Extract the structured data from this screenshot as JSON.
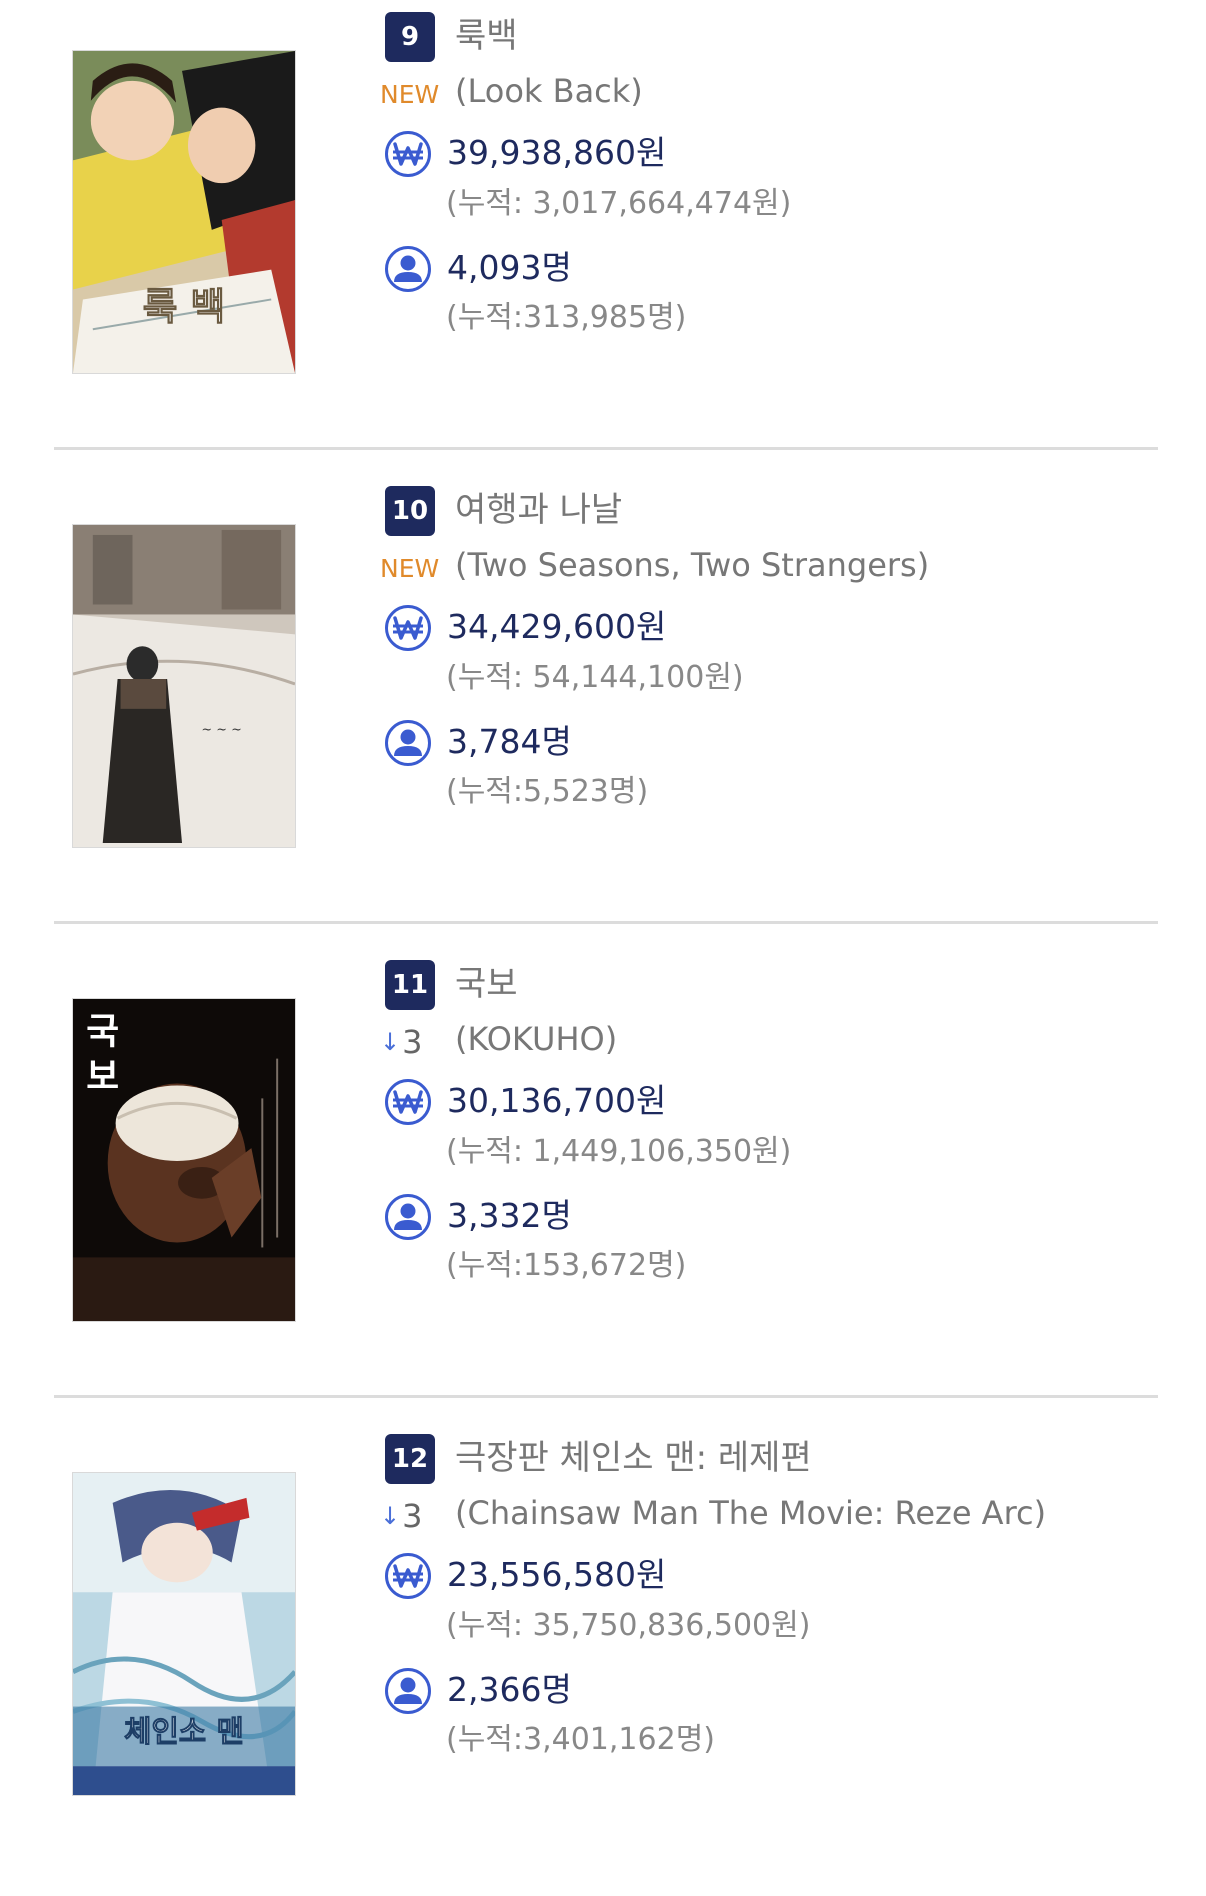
{
  "colors": {
    "rank_bg": "#1e2a5e",
    "value_text": "#1e2a5e",
    "new_badge": "#e08a2b",
    "down_arrow": "#4a6fd8",
    "icon": "#3a5bd0"
  },
  "movies": [
    {
      "rank": "9",
      "title_kr": "룩백",
      "title_en": "(Look Back)",
      "change_type": "new",
      "change_label": "NEW",
      "change_arrow": "",
      "change_value": "",
      "revenue": "39,938,860원",
      "revenue_cum": "(누적: 3,017,664,474원)",
      "audience": "4,093명",
      "audience_cum": "(누적:313,985명)",
      "poster_text": "룩 백",
      "poster_icon": "anime-poster"
    },
    {
      "rank": "10",
      "title_kr": "여행과 나날",
      "title_en": "(Two Seasons, Two Strangers)",
      "change_type": "new",
      "change_label": "NEW",
      "change_arrow": "",
      "change_value": "",
      "revenue": "34,429,600원",
      "revenue_cum": "(누적: 54,144,100원)",
      "audience": "3,784명",
      "audience_cum": "(누적:5,523명)",
      "poster_text": "",
      "poster_icon": "snow-poster"
    },
    {
      "rank": "11",
      "title_kr": "국보",
      "title_en": "(KOKUHO)",
      "change_type": "down",
      "change_label": "",
      "change_arrow": "↓",
      "change_value": "3",
      "revenue": "30,136,700원",
      "revenue_cum": "(누적: 1,449,106,350원)",
      "audience": "3,332명",
      "audience_cum": "(누적:153,672명)",
      "poster_text": "국 보",
      "poster_icon": "dark-poster"
    },
    {
      "rank": "12",
      "title_kr": "극장판 체인소 맨: 레제편",
      "title_en": "(Chainsaw Man The Movie: Reze Arc)",
      "change_type": "down",
      "change_label": "",
      "change_arrow": "↓",
      "change_value": "3",
      "revenue": "23,556,580원",
      "revenue_cum": "(누적: 35,750,836,500원)",
      "audience": "2,366명",
      "audience_cum": "(누적:3,401,162명)",
      "poster_text": "체인소 맨",
      "poster_icon": "anime-poster"
    }
  ]
}
